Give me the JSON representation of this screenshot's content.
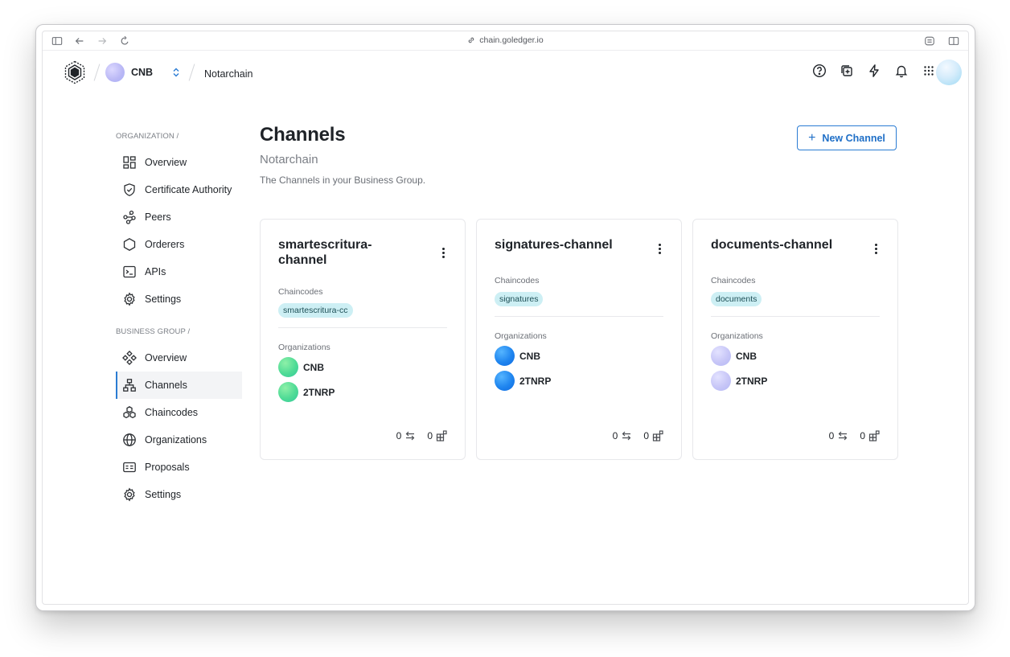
{
  "browser": {
    "url": "chain.goledger.io"
  },
  "header": {
    "org_name": "CNB",
    "breadcrumb_title": "Notarchain"
  },
  "sidebar": {
    "org_section": "ORGANIZATION /",
    "org_items": [
      {
        "label": "Overview",
        "icon": "grid-icon"
      },
      {
        "label": "Certificate Authority",
        "icon": "shield-check-icon"
      },
      {
        "label": "Peers",
        "icon": "peers-icon"
      },
      {
        "label": "Orderers",
        "icon": "hexagon-icon"
      },
      {
        "label": "APIs",
        "icon": "terminal-icon"
      },
      {
        "label": "Settings",
        "icon": "gear-icon"
      }
    ],
    "bg_section": "BUSINESS GROUP /",
    "bg_items": [
      {
        "label": "Overview",
        "icon": "nodes-icon"
      },
      {
        "label": "Channels",
        "icon": "hierarchy-icon",
        "active": true
      },
      {
        "label": "Chaincodes",
        "icon": "cubes-icon"
      },
      {
        "label": "Organizations",
        "icon": "globe-icon"
      },
      {
        "label": "Proposals",
        "icon": "id-card-icon"
      },
      {
        "label": "Settings",
        "icon": "gear-icon"
      }
    ]
  },
  "main": {
    "title": "Channels",
    "subtitle": "Notarchain",
    "description": "The Channels in your Business Group.",
    "new_button": "New Channel"
  },
  "cards": [
    {
      "name": "smartescritura-channel",
      "name_line1": "smartescritura-",
      "name_line2": "channel",
      "chaincodes_label": "Chaincodes",
      "chaincode": "smartescritura-cc",
      "organizations_label": "Organizations",
      "orgs": [
        "CNB",
        "2TNRP"
      ],
      "transactions": "0",
      "blocks": "0"
    },
    {
      "name": "signatures-channel",
      "chaincodes_label": "Chaincodes",
      "chaincode": "signatures",
      "organizations_label": "Organizations",
      "orgs": [
        "CNB",
        "2TNRP"
      ],
      "transactions": "0",
      "blocks": "0"
    },
    {
      "name": "documents-channel",
      "chaincodes_label": "Chaincodes",
      "chaincode": "documents",
      "organizations_label": "Organizations",
      "orgs": [
        "CNB",
        "2TNRP"
      ],
      "transactions": "0",
      "blocks": "0"
    }
  ],
  "colors": {
    "accent": "#2b7cd3",
    "badge_bg": "#cdeff4",
    "org_avatar_green": "#4fdb96",
    "org_avatar_blue": "#1f85ef",
    "org_avatar_lavender": "#c7c6f7"
  }
}
